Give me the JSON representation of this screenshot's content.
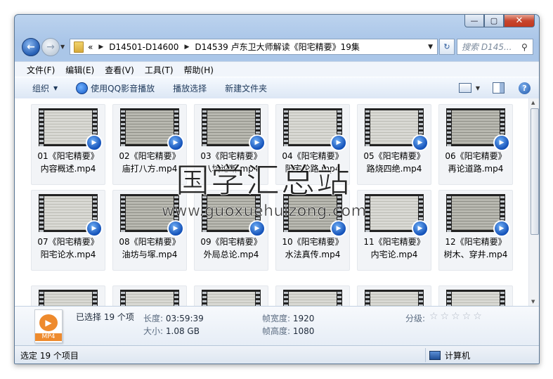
{
  "window": {
    "caption_buttons": {
      "minimize": "—",
      "maximize": "▢",
      "close": "✕"
    }
  },
  "nav": {
    "breadcrumb": [
      "D14501-D14600",
      "D14539 卢东卫大师解读《阳宅精要》19集"
    ],
    "chevrons": "«",
    "search_placeholder": "搜索 D145..."
  },
  "menu": [
    "文件(F)",
    "编辑(E)",
    "查看(V)",
    "工具(T)",
    "帮助(H)"
  ],
  "toolbar": {
    "organize": "组织",
    "play_qq": "使用QQ影音播放",
    "play_selection": "播放选择",
    "new_folder": "新建文件夹"
  },
  "files": [
    {
      "line1": "01《阳宅精要》",
      "line2": "内容概述.mp4"
    },
    {
      "line1": "02《阳宅精要》",
      "line2": "庙打八方.mp4"
    },
    {
      "line1": "03《阳宅精要》",
      "line2": "八坑论断.mp4"
    },
    {
      "line1": "04《阳宅精要》",
      "line2": "阳宅论路.mp4"
    },
    {
      "line1": "05《阳宅精要》",
      "line2": "路烧四绝.mp4"
    },
    {
      "line1": "06《阳宅精要》",
      "line2": "再论道路.mp4"
    },
    {
      "line1": "07《阳宅精要》",
      "line2": "阳宅论水.mp4"
    },
    {
      "line1": "08《阳宅精要》",
      "line2": "油坊与塚.mp4"
    },
    {
      "line1": "09《阳宅精要》",
      "line2": "外局总论.mp4"
    },
    {
      "line1": "10《阳宅精要》",
      "line2": "水法真传.mp4"
    },
    {
      "line1": "11《阳宅精要》",
      "line2": "内宅论.mp4"
    },
    {
      "line1": "12《阳宅精要》",
      "line2": "树木、穿井.mp4"
    }
  ],
  "watermark": {
    "cn": "国学汇总站",
    "url": "www.guoxuehuizong.com"
  },
  "details": {
    "selected": "已选择 19 个项",
    "file_icon_label": "MP4",
    "length_label": "长度:",
    "length": "03:59:39",
    "size_label": "大小:",
    "size": "1.08 GB",
    "frame_width_label": "帧宽度:",
    "frame_width": "1920",
    "frame_height_label": "帧高度:",
    "frame_height": "1080",
    "rating_label": "分级:",
    "rating_stars": "☆☆☆☆☆"
  },
  "status": {
    "left": "选定 19 个项目",
    "right": "计算机"
  }
}
